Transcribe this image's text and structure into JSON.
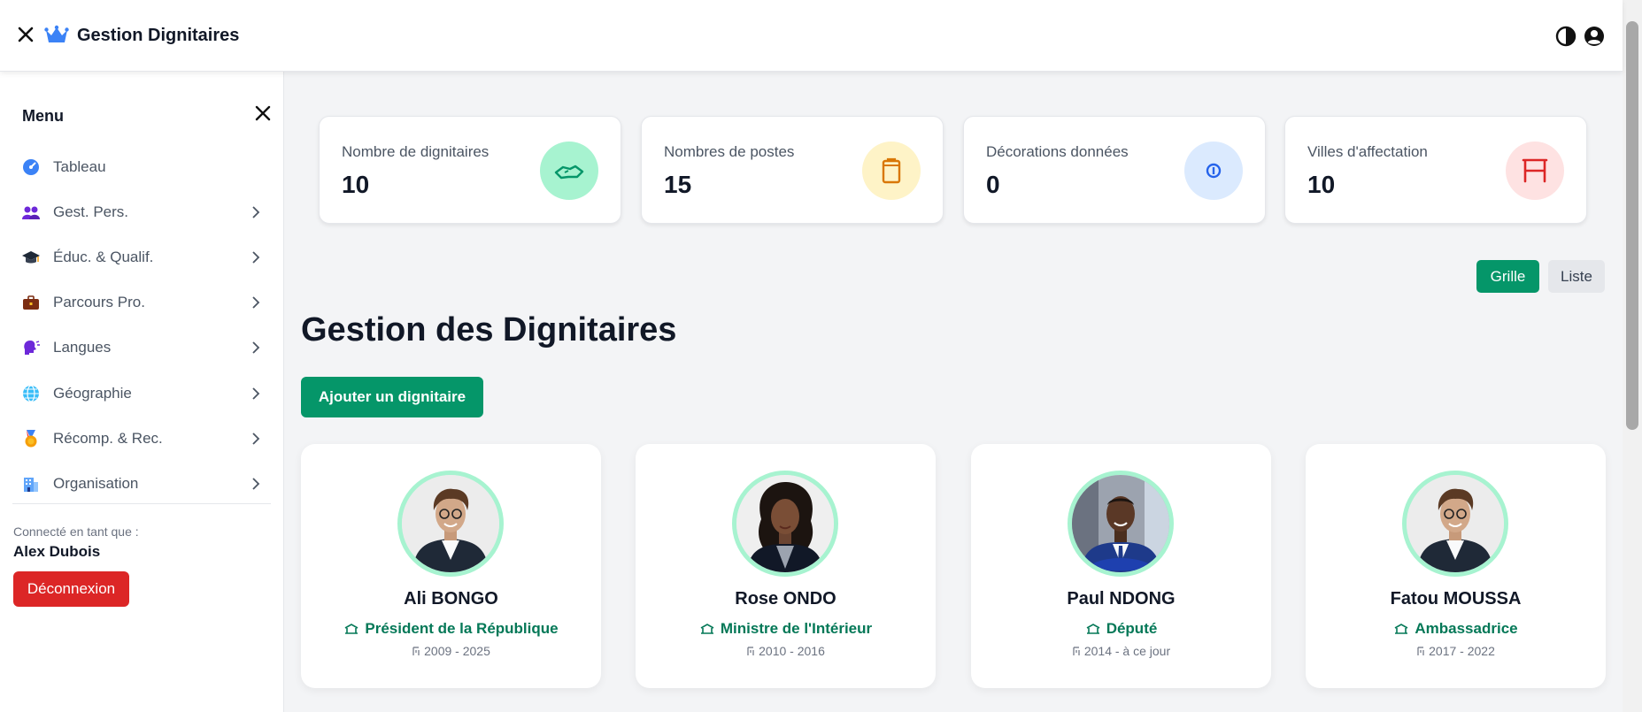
{
  "app": {
    "title": "Gestion Dignitaires"
  },
  "sidebar": {
    "menu_title": "Menu",
    "items": [
      {
        "label": "Tableau",
        "icon": "dashboard-icon",
        "has_chevron": false
      },
      {
        "label": "Gest. Pers.",
        "icon": "people-icon",
        "has_chevron": true
      },
      {
        "label": "Éduc. & Qualif.",
        "icon": "graduation-cap-icon",
        "has_chevron": true
      },
      {
        "label": "Parcours Pro.",
        "icon": "briefcase-icon",
        "has_chevron": true
      },
      {
        "label": "Langues",
        "icon": "speaking-head-icon",
        "has_chevron": true
      },
      {
        "label": "Géographie",
        "icon": "globe-icon",
        "has_chevron": true
      },
      {
        "label": "Récomp. & Rec.",
        "icon": "medal-icon",
        "has_chevron": true
      },
      {
        "label": "Organisation",
        "icon": "building-icon",
        "has_chevron": true
      }
    ],
    "connected_label": "Connecté en tant que :",
    "username": "Alex Dubois",
    "logout_label": "Déconnexion"
  },
  "stats": [
    {
      "label": "Nombre de dignitaires",
      "value": "10",
      "icon": "handshake-icon",
      "color": "#059669",
      "bg": "#a7f3d0"
    },
    {
      "label": "Nombres de postes",
      "value": "15",
      "icon": "clipboard-icon",
      "color": "#d97706",
      "bg": "#fef3c7"
    },
    {
      "label": "Décorations données",
      "value": "0",
      "icon": "medal-icon",
      "color": "#2563eb",
      "bg": "#dbeafe"
    },
    {
      "label": "Villes d'affectation",
      "value": "10",
      "icon": "city-icon",
      "color": "#dc2626",
      "bg": "#fee2e2"
    }
  ],
  "view_toggle": {
    "grid_label": "Grille",
    "list_label": "Liste",
    "active": "Grille"
  },
  "main": {
    "title": "Gestion des Dignitaires",
    "add_button": "Ajouter un dignitaire"
  },
  "dignitaries": [
    {
      "name": "Ali BONGO",
      "role": "Président de la République",
      "years": "2009 - 2025"
    },
    {
      "name": "Rose ONDO",
      "role": "Ministre de l'Intérieur",
      "years": "2010 - 2016"
    },
    {
      "name": "Paul NDONG",
      "role": "Député",
      "years": "2014 - à ce jour"
    },
    {
      "name": "Fatou MOUSSA",
      "role": "Ambassadrice",
      "years": "2017 - 2022"
    }
  ],
  "colors": {
    "accent": "#059669",
    "danger": "#dc2626",
    "role_text": "#047857"
  }
}
